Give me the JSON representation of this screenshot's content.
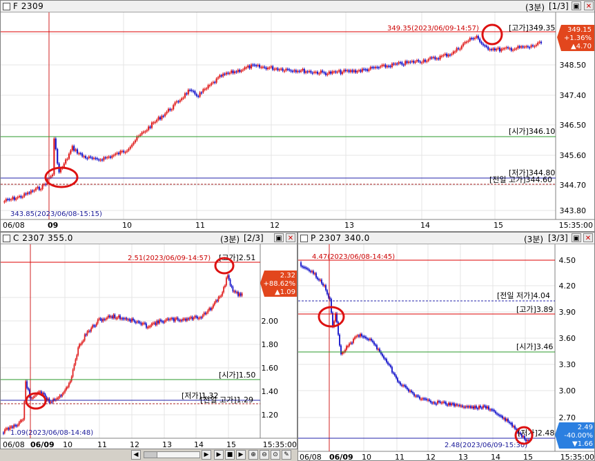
{
  "colors": {
    "up": "#e02020",
    "down": "#1a1acc",
    "high_line": "#dd0000",
    "low_line": "#2020aa",
    "open_line": "#2a9a2a",
    "prev_line": "#aa2020",
    "circle": "#dd1111",
    "badge_up": "#e2461d",
    "badge_down": "#2b7fe0"
  },
  "pane_main": {
    "title": "F 2309",
    "period": "(3분)",
    "index": "[1/3]",
    "price_labels": [
      "349.15",
      "348.50",
      "347.40",
      "346.50",
      "345.60",
      "344.70",
      "343.80"
    ],
    "time_labels": [
      "06/08",
      "09",
      "10",
      "11",
      "12",
      "13",
      "14",
      "15"
    ],
    "clock": "15:35:00",
    "high_annot": "349.35(2023/06/09-14:57)",
    "high_tag": "[고가]349.35",
    "open_tag": "[시가]346.10",
    "low_tag": "[저가]344.80",
    "prev_low_tag": "[전일 고가]344.60",
    "low_annot": "343.85(2023/06/08-15:15)",
    "badge": {
      "price": "349.15",
      "pct": "+1.36%",
      "chg": "▲4.70"
    },
    "marks": {
      "prev_high": 344.6,
      "low": 344.8,
      "open": 346.1,
      "high": 349.35,
      "last": 349.15
    }
  },
  "pane_call": {
    "title": "C 2307 355.0",
    "period": "(3분)",
    "index": "[2/3]",
    "price_labels": [
      "2.20",
      "2.00",
      "1.80",
      "1.60",
      "1.40",
      "1.20"
    ],
    "time_labels": [
      "06/08",
      "06/09",
      "10",
      "11",
      "12",
      "13",
      "14",
      "15"
    ],
    "clock": "15:35:00",
    "high_annot": "2.51(2023/06/09-14:57)",
    "high_tag": "[고가]2.51",
    "open_tag": "[시가]1.50",
    "low_tag": "[저가]1.32",
    "prev_high_tag": "[전일 고가]1.29",
    "low_annot": "1.09(2023/06/08-14:48)",
    "badge": {
      "price": "2.32",
      "pct": "+88.62%",
      "chg": "▲1.09"
    },
    "marks": {
      "prev_high": 1.29,
      "low": 1.32,
      "open": 1.5,
      "high": 2.51,
      "last": 2.32
    }
  },
  "pane_put": {
    "title": "P 2307 340.0",
    "period": "(3분)",
    "index": "[3/3]",
    "price_labels": [
      "4.50",
      "4.20",
      "3.90",
      "3.60",
      "3.30",
      "3.00",
      "2.70"
    ],
    "time_labels": [
      "06/08",
      "06/09",
      "10",
      "11",
      "12",
      "13",
      "14",
      "15"
    ],
    "clock": "15:35:00",
    "high_annot": "4.47(2023/06/08-14:45)",
    "prev_low_tag": "[전일 저가]4.04",
    "high_tag": "[고가]3.89",
    "open_tag": "[시가]3.46",
    "low_tag": "[저가]2.48",
    "low_annot": "2.48(2023/06/09-15:30)",
    "badge": {
      "price": "2.49",
      "pct": "-40.00%",
      "chg": "▼1.66"
    },
    "marks": {
      "prev_low": 4.04,
      "high": 3.89,
      "open": 3.46,
      "low": 2.48,
      "last": 2.49
    }
  },
  "toolbar": {
    "icons": [
      "play-icon",
      "stop-icon",
      "next-icon",
      "zoom-in-icon",
      "zoom-out-icon",
      "zoom-reset-icon",
      "tool-icon"
    ]
  }
}
